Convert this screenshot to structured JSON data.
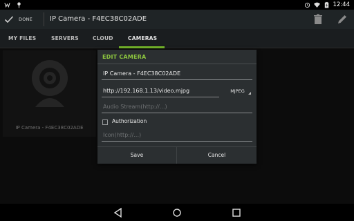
{
  "status_bar": {
    "time": "12:44"
  },
  "action_bar": {
    "done_label": "DONE",
    "title": "IP Camera - F4EC38C02ADE"
  },
  "tabs": [
    {
      "label": "MY FILES",
      "active": false
    },
    {
      "label": "SERVERS",
      "active": false
    },
    {
      "label": "CLOUD",
      "active": false
    },
    {
      "label": "CAMERAS",
      "active": true
    }
  ],
  "camera_card": {
    "label": "IP Camera - F4EC38C02ADE"
  },
  "dialog": {
    "title": "EDIT CAMERA",
    "name_value": "IP Camera - F4EC38C02ADE",
    "url_value": "http://192.168.1.13/video.mjpg",
    "format_selected": "MJPEG",
    "audio_placeholder": "Audio Stream(http://...)",
    "authorization_label": "Authorization",
    "authorization_checked": false,
    "icon_placeholder": "Icon(http://...)",
    "save_label": "Save",
    "cancel_label": "Cancel"
  },
  "colors": {
    "accent": "#73b32a",
    "dialog_title": "#8dc63f",
    "action_bar": "#1f2426",
    "dialog_bg": "#2b2f31"
  }
}
